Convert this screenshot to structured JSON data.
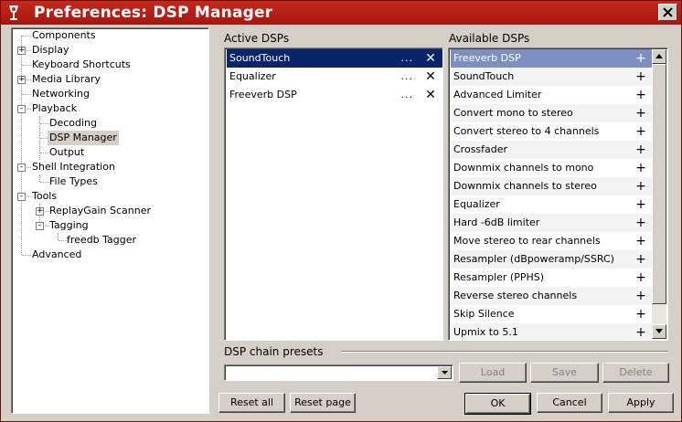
{
  "window": {
    "title": "Preferences: DSP Manager"
  },
  "tree": {
    "items": [
      {
        "label": "Components",
        "expander": ""
      },
      {
        "label": "Display",
        "expander": "+"
      },
      {
        "label": "Keyboard Shortcuts",
        "expander": ""
      },
      {
        "label": "Media Library",
        "expander": "+"
      },
      {
        "label": "Networking",
        "expander": ""
      },
      {
        "label": "Playback",
        "expander": "-"
      },
      {
        "label": "Decoding",
        "expander": ""
      },
      {
        "label": "DSP Manager",
        "expander": ""
      },
      {
        "label": "Output",
        "expander": ""
      },
      {
        "label": "Shell Integration",
        "expander": "-"
      },
      {
        "label": "File Types",
        "expander": ""
      },
      {
        "label": "Tools",
        "expander": "-"
      },
      {
        "label": "ReplayGain Scanner",
        "expander": "+"
      },
      {
        "label": "Tagging",
        "expander": "-"
      },
      {
        "label": "freedb Tagger",
        "expander": ""
      },
      {
        "label": "Advanced",
        "expander": ""
      }
    ],
    "selected": "DSP Manager"
  },
  "active_dsps": {
    "label": "Active DSPs",
    "configure_glyph": "...",
    "remove_glyph": "✕",
    "items": [
      "SoundTouch",
      "Equalizer",
      "Freeverb DSP"
    ]
  },
  "available_dsps": {
    "label": "Available DSPs",
    "add_glyph": "+",
    "items": [
      "Freeverb DSP",
      "SoundTouch",
      "Advanced Limiter",
      "Convert mono to stereo",
      "Convert stereo to 4 channels",
      "Crossfader",
      "Downmix channels to mono",
      "Downmix channels to stereo",
      "Equalizer",
      "Hard -6dB limiter",
      "Move stereo to rear channels",
      "Resampler (dBpoweramp/SSRC)",
      "Resampler (PPHS)",
      "Reverse stereo channels",
      "Skip Silence",
      "Upmix to 5.1"
    ]
  },
  "presets": {
    "label": "DSP chain presets",
    "value": "",
    "load_label": "Load",
    "save_label": "Save",
    "delete_label": "Delete"
  },
  "footer": {
    "reset_all_label": "Reset all",
    "reset_page_label": "Reset page",
    "ok_label": "OK",
    "cancel_label": "Cancel",
    "apply_label": "Apply"
  },
  "colors": {
    "titlebar": "#b41f15",
    "selection": "#0a246a",
    "available_selection": "#7d8fbf",
    "face": "#d4d0c8"
  }
}
